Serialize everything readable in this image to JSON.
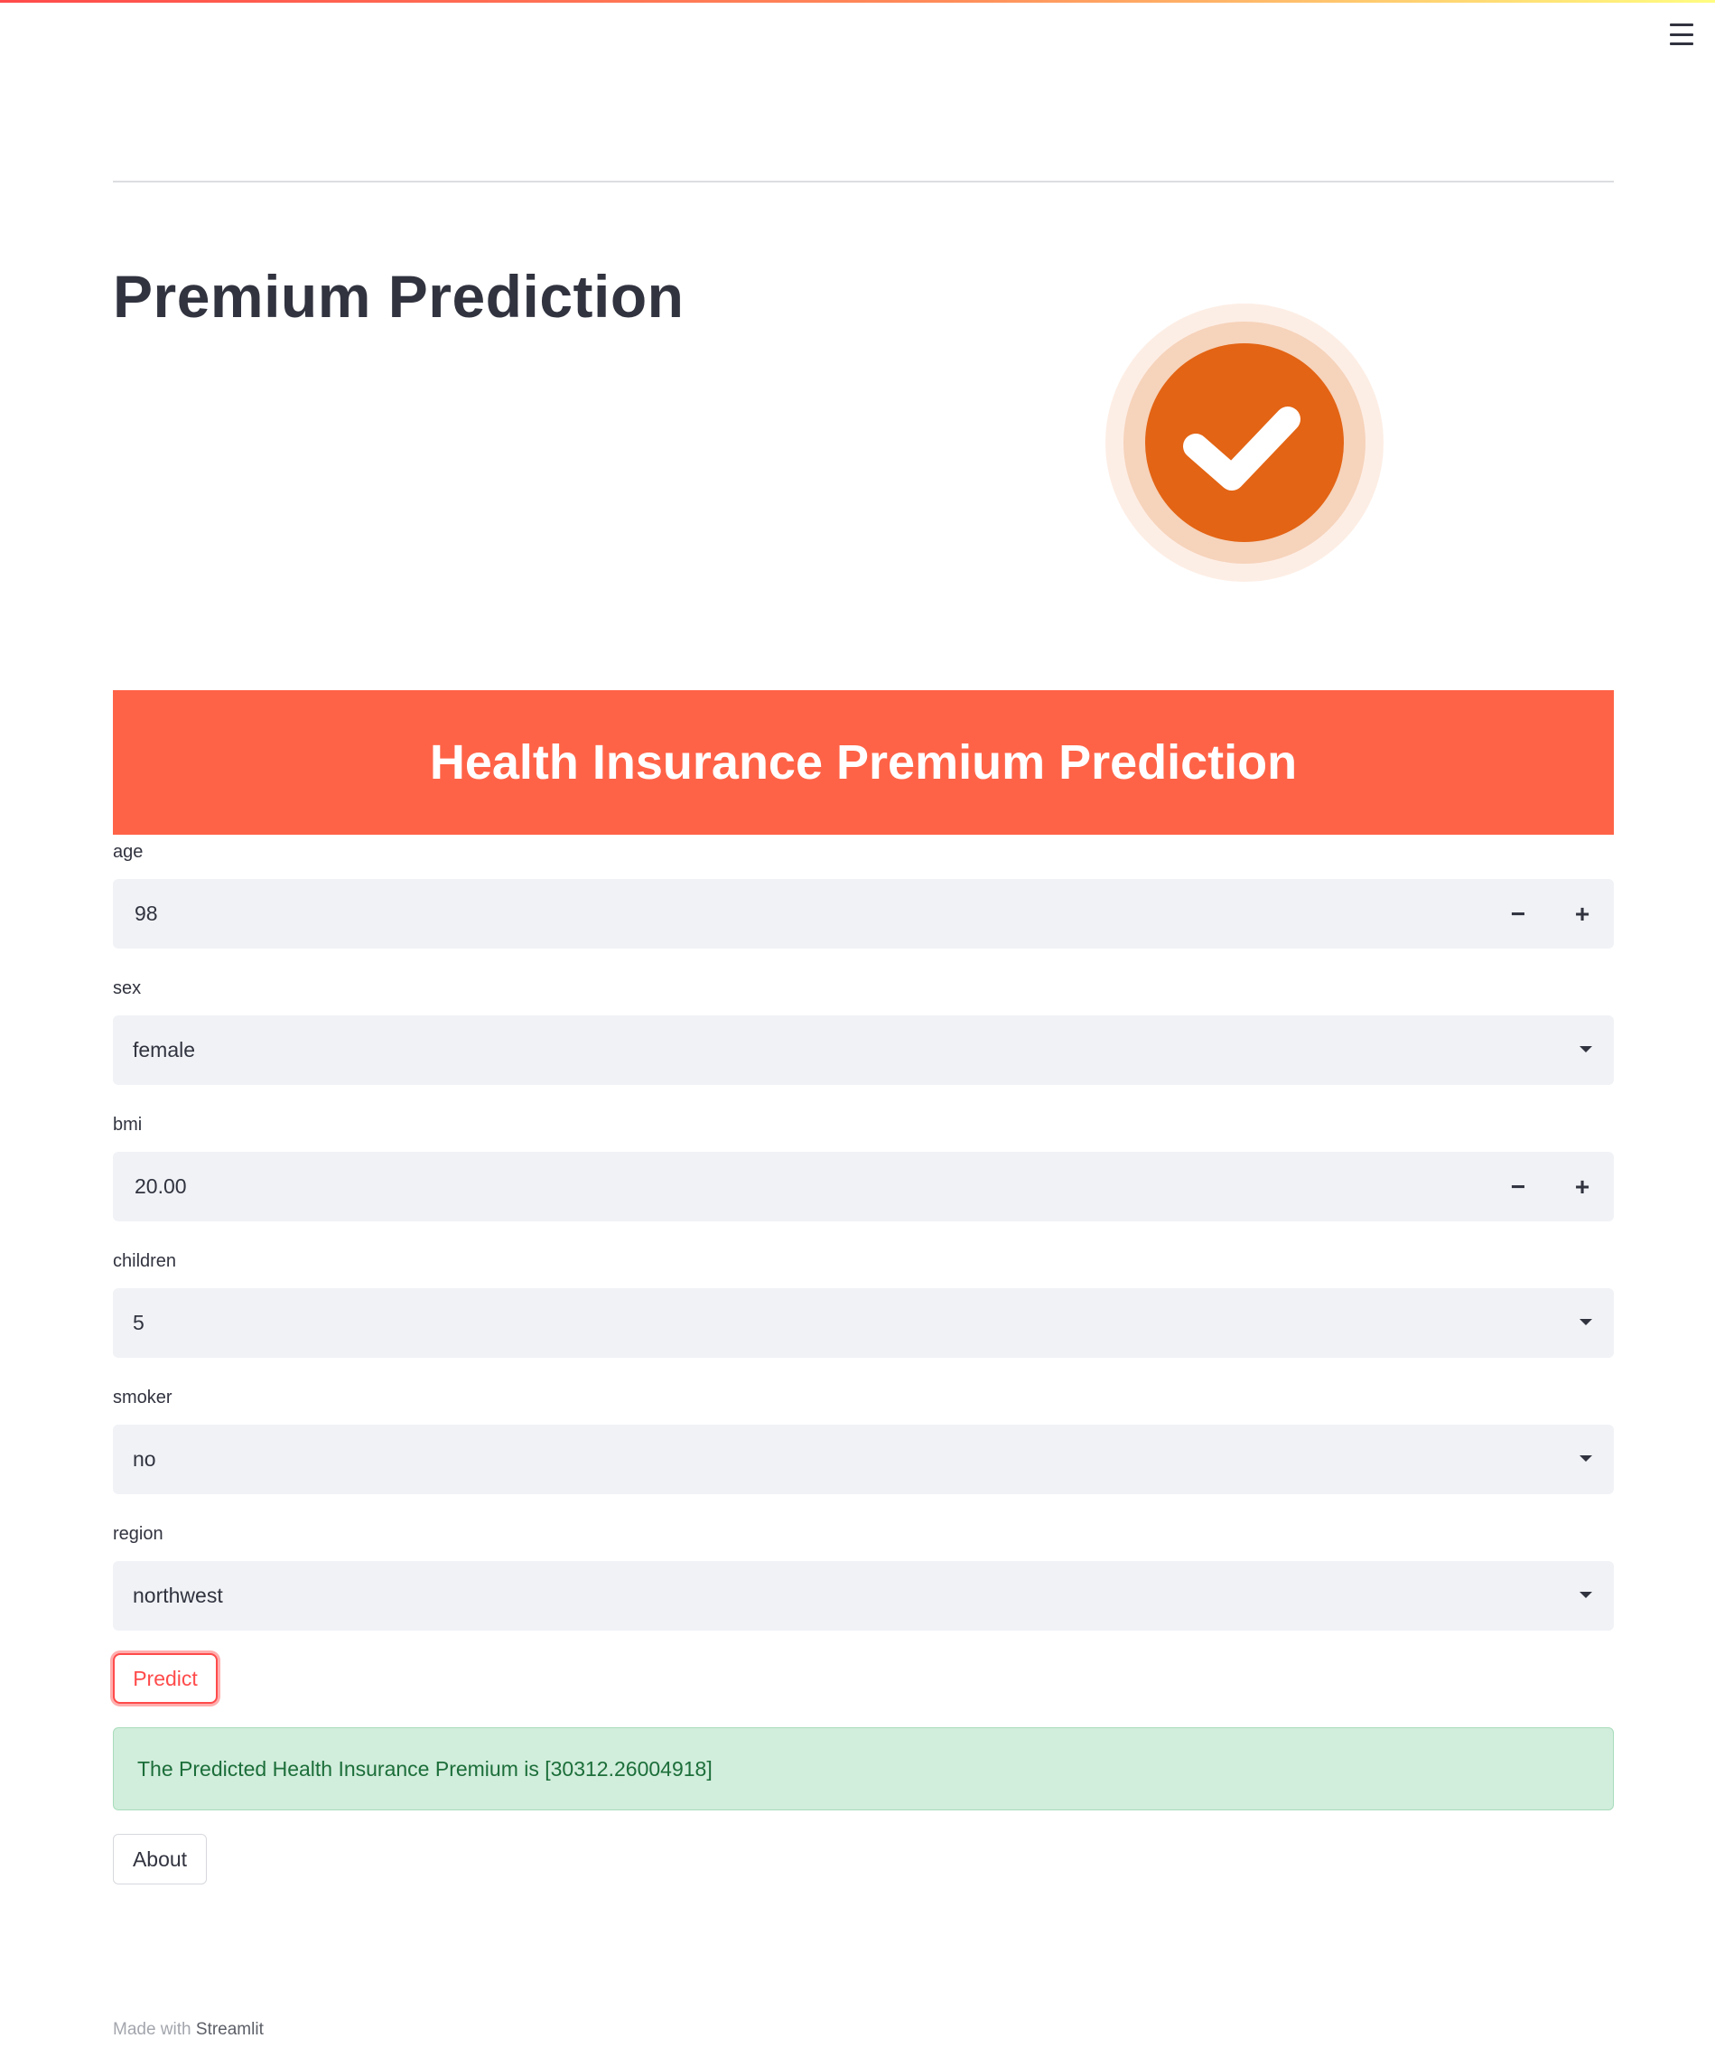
{
  "app": {
    "title": "Premium Prediction",
    "banner_title": "Health Insurance Premium Prediction"
  },
  "colors": {
    "accent": "#ff4b4b",
    "banner_bg": "#ff6347",
    "badge_orange": "#e36414",
    "success_bg": "#d1eddb",
    "success_text": "#1c6e3a",
    "field_bg": "#f0f2f6"
  },
  "icons": {
    "menu": "hamburger-menu-icon",
    "badge": "check-circle-icon",
    "dropdown": "caret-down-icon"
  },
  "form": {
    "age": {
      "label": "age",
      "value": "98",
      "minus": "−",
      "plus": "+"
    },
    "sex": {
      "label": "sex",
      "value": "female"
    },
    "bmi": {
      "label": "bmi",
      "value": "20.00",
      "minus": "−",
      "plus": "+"
    },
    "children": {
      "label": "children",
      "value": "5"
    },
    "smoker": {
      "label": "smoker",
      "value": "no"
    },
    "region": {
      "label": "region",
      "value": "northwest"
    }
  },
  "actions": {
    "predict_label": "Predict",
    "about_label": "About"
  },
  "result": {
    "text": "The Predicted Health Insurance Premium is [30312.26004918]"
  },
  "footer": {
    "prefix": "Made with",
    "link": "Streamlit"
  }
}
